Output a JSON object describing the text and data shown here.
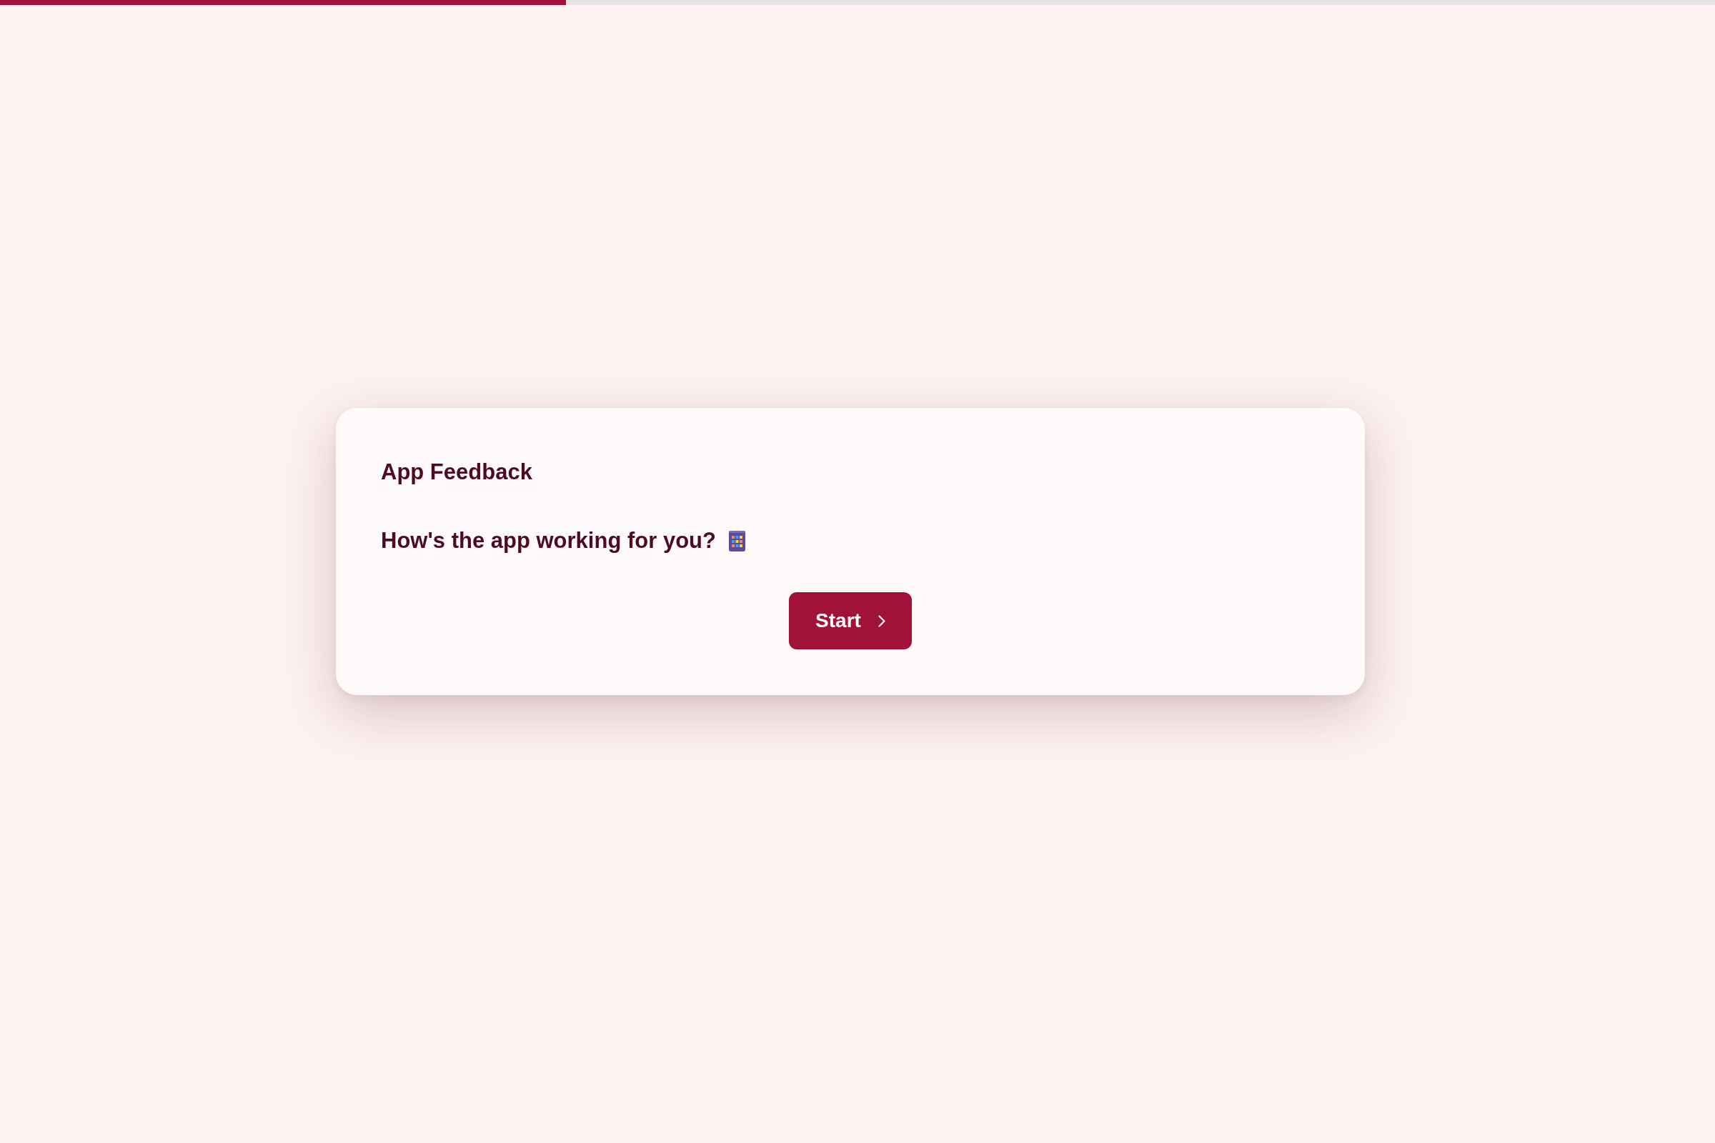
{
  "progress": {
    "level": 0.33
  },
  "card": {
    "title": "App Feedback",
    "question": "How's the app working for you?",
    "start_button": {
      "label": "Start"
    }
  }
}
